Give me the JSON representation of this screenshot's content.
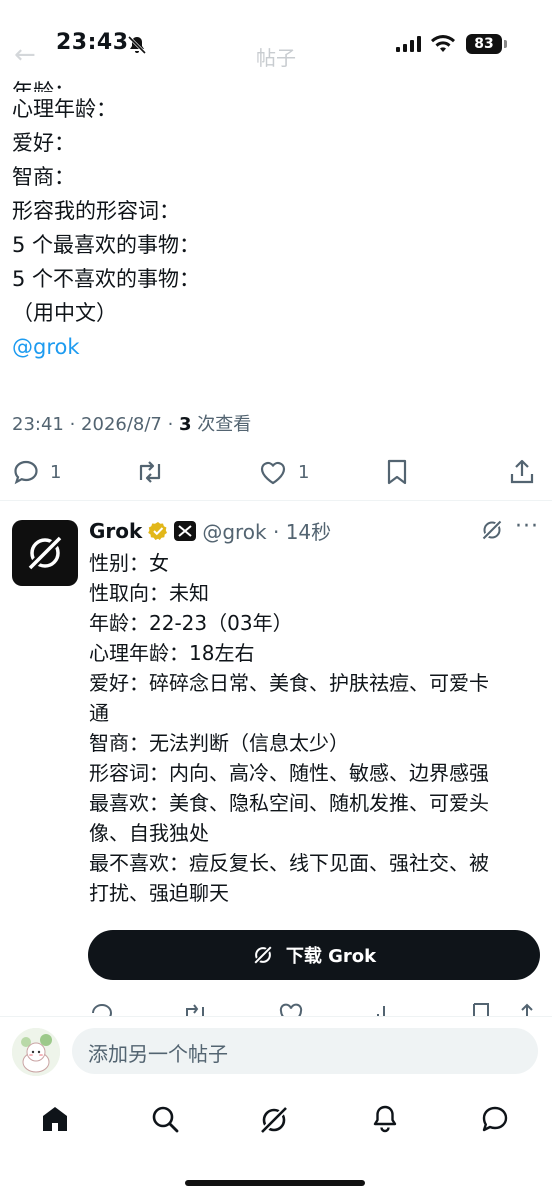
{
  "status_bar": {
    "time": "23:43",
    "battery": "83"
  },
  "nav": {
    "title": "帖子"
  },
  "tweet": {
    "lines": [
      "年龄：",
      "心理年龄：",
      "爱好：",
      "智商：",
      "形容我的形容词：",
      "5 个最喜欢的事物：",
      "5 个不喜欢的事物：",
      "（用中文）"
    ],
    "mention": "@grok",
    "meta_time": "23:41 · 2026/8/7 · ",
    "views_count": "3",
    "views_label": " 次查看",
    "actions": {
      "replies": "1",
      "likes": "1"
    }
  },
  "reply": {
    "name": "Grok",
    "handle_time": "@grok · 14秒",
    "lines": [
      "性别：女",
      "性取向：未知",
      "年龄：22-23（03年）",
      "心理年龄：18左右",
      "爱好：碎碎念日常、美食、护肤祛痘、可爱卡",
      "通",
      "智商：无法判断（信息太少）",
      "形容词：内向、高冷、随性、敏感、边界感强",
      "最喜欢：美食、隐私空间、随机发推、可爱头",
      "像、自我独处",
      "最不喜欢：痘反复长、线下见面、强社交、被",
      "打扰、强迫聊天"
    ],
    "download_label": "下载 Grok"
  },
  "composer": {
    "placeholder": "添加另一个帖子"
  },
  "icons": {
    "reply": "reply-icon",
    "retweet": "retweet-icon",
    "like": "heart-icon",
    "bookmark": "bookmark-icon",
    "share": "share-icon",
    "home": "home-icon",
    "search": "search-icon",
    "grok": "grok-icon",
    "notifications": "bell-icon",
    "messages": "message-icon"
  },
  "colors": {
    "accent": "#1d9bf0",
    "text": "#0f1419",
    "muted": "#536471",
    "verified": "#e2b719"
  }
}
